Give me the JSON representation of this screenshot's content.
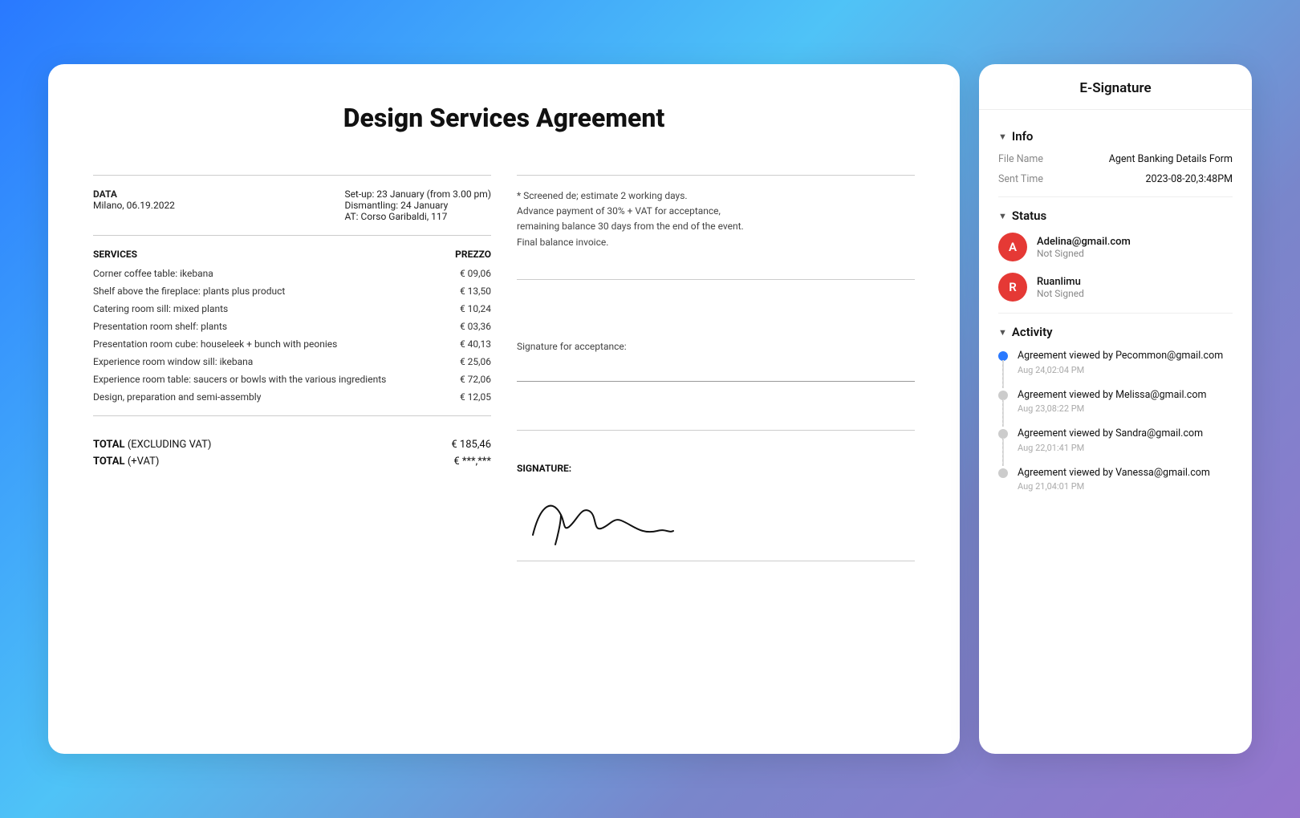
{
  "esig": {
    "title": "E-Signature",
    "info": {
      "section_label": "Info",
      "file_name_key": "File Name",
      "file_name_val": "Agent Banking Details Form",
      "sent_time_key": "Sent Time",
      "sent_time_val": "2023-08-20,3:48PM"
    },
    "status": {
      "section_label": "Status",
      "signers": [
        {
          "initial": "A",
          "email": "Adelina@gmail.com",
          "status": "Not Signed"
        },
        {
          "initial": "R",
          "email": "Ruanlimu",
          "status": "Not Signed"
        }
      ]
    },
    "activity": {
      "section_label": "Activity",
      "items": [
        {
          "active": true,
          "text": "Agreement viewed by",
          "email": "Pecommon@gmail.com",
          "time": "Aug 24,02:04 PM"
        },
        {
          "active": false,
          "text": "Agreement viewed by",
          "email": "Melissa@gmail.com",
          "time": "Aug 23,08:22 PM"
        },
        {
          "active": false,
          "text": "Agreement viewed by",
          "email": "Sandra@gmail.com",
          "time": "Aug 22,01:41 PM"
        },
        {
          "active": false,
          "text": "Agreement viewed by",
          "email": "Vanessa@gmail.com",
          "time": "Aug 21,04:01 PM"
        }
      ]
    }
  },
  "document": {
    "title": "Design Services Agreement",
    "data_label": "DATA",
    "data_location": "Milano, 06.19.2022",
    "data_setup": "Set-up: 23 January (from 3.00 pm)",
    "data_dismantling": "Dismantling: 24 January",
    "data_at": "AT: Corso Garibaldi, 117",
    "note": "* Screened de; estimate 2 working days.\nAdvance payment of 30% + VAT for acceptance,\nremaining balance 30 days from the end of the event.\nFinal balance invoice.",
    "services_label": "SERVICES",
    "price_label": "PREZZO",
    "services": [
      {
        "name": "Corner coffee table: ikebana",
        "price": "€ 09,06"
      },
      {
        "name": "Shelf above the fireplace: plants plus product",
        "price": "€ 13,50"
      },
      {
        "name": "Catering room sill: mixed plants",
        "price": "€ 10,24"
      },
      {
        "name": "Presentation room shelf: plants",
        "price": "€ 03,36"
      },
      {
        "name": "Presentation room cube: houseleek + bunch with peonies",
        "price": "€ 40,13"
      },
      {
        "name": "Experience room window sill: ikebana",
        "price": "€ 25,06"
      },
      {
        "name": "Experience room table: saucers or bowls with the various ingredients",
        "price": "€ 72,06"
      },
      {
        "name": "Design, preparation and semi-assembly",
        "price": "€ 12,05"
      }
    ],
    "total_excl_label": "TOTAL",
    "total_excl_note": "(EXCLUDING VAT)",
    "total_excl_val": "€ 185,46",
    "total_vat_label": "TOTAL",
    "total_vat_note": "(+VAT)",
    "total_vat_val": "€ ***,***",
    "signature_for_acceptance": "Signature for acceptance:",
    "signature_label": "SIGNATURE:"
  }
}
